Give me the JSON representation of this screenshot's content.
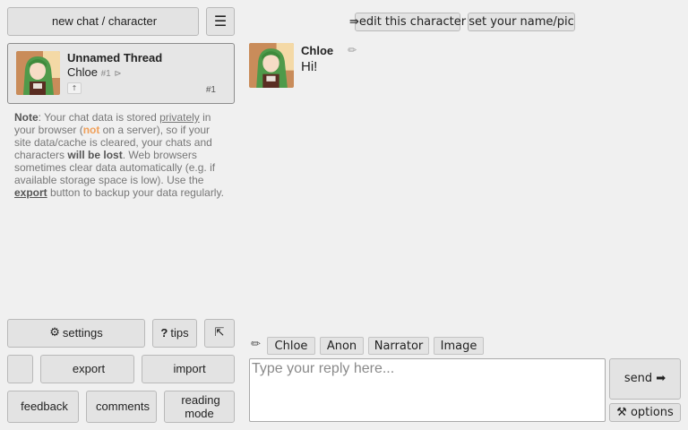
{
  "sidebar": {
    "new_chat": {
      "icon": "",
      "label": "new chat / character"
    },
    "menu_icon": "☰",
    "thread": {
      "title": "Unnamed Thread",
      "character": "Chloe",
      "num": "#1",
      "tag_icon": "⊳",
      "up_glyph": "↑",
      "count": "#1",
      "side_icons": [
        "",
        "",
        ""
      ]
    },
    "note": {
      "p1": "Note",
      "p2": ": Your chat data is stored ",
      "p3": "privately",
      "p4": " in your browser (",
      "p5": "not",
      "p6": " on a server), so if your site data/cache is cleared, your chats and characters ",
      "p7": "will be lost",
      "p8": ". Web browsers sometimes clear data automatically  (e.g. if available storage space is low). Use the ",
      "p9": "export",
      "p10": " button to backup your data regularly."
    },
    "buttons": {
      "settings": {
        "icon": "⚙",
        "label": "settings"
      },
      "tips": {
        "icon": "?",
        "label": "tips"
      },
      "collapse": "⇱",
      "row2_icon": "",
      "export": {
        "icon": "",
        "label": "export"
      },
      "import": {
        "icon": "",
        "label": "import"
      },
      "feedback": {
        "icon": "",
        "label": "feedback"
      },
      "comments": {
        "icon": "",
        "label": "comments"
      },
      "reading": {
        "icon": "",
        "label": "reading mode"
      }
    }
  },
  "chat": {
    "edit_character": "⇛edit this character",
    "set_name": " set your name/pic",
    "message": {
      "author": "Chloe",
      "tools": [
        "✏",
        "",
        ""
      ],
      "text": "Hi! "
    },
    "reply_bar": {
      "pencil": "✏",
      "chips": [
        " Chloe",
        " Anon",
        " Narrator",
        " Image"
      ]
    },
    "reply_placeholder": "Type your reply here...",
    "send": "send ➡",
    "options": "⚒ options"
  },
  "colors": {
    "background": "#f0f0f0",
    "button": "#e3e3e3",
    "warn": "#f0a05a",
    "avatar_hair": "#4f9a4a"
  }
}
